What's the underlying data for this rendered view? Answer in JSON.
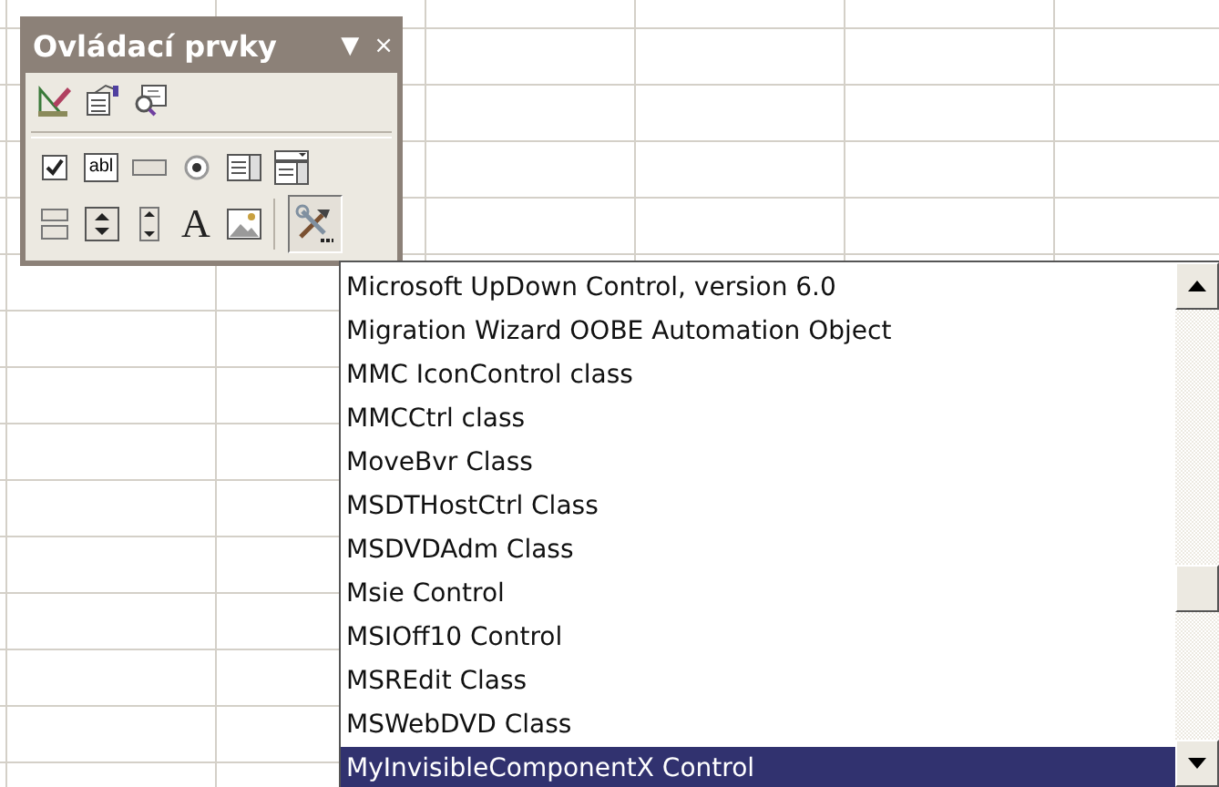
{
  "toolbar": {
    "title": "Ovládací prvky",
    "menu_glyph": "▼",
    "close_glyph": "×",
    "rows": [
      [
        {
          "kind": "design",
          "pressed": false
        },
        {
          "kind": "properties",
          "pressed": false
        },
        {
          "kind": "code",
          "pressed": false
        }
      ],
      [
        {
          "kind": "checkbox",
          "pressed": false
        },
        {
          "kind": "textbox",
          "glyph": "abl",
          "pressed": false
        },
        {
          "kind": "button",
          "pressed": false
        },
        {
          "kind": "option",
          "pressed": false
        },
        {
          "kind": "listbox",
          "pressed": false
        },
        {
          "kind": "combobox",
          "pressed": false
        }
      ],
      [
        {
          "kind": "toggle",
          "pressed": false
        },
        {
          "kind": "spin",
          "pressed": false
        },
        {
          "kind": "scrollbar",
          "pressed": false
        },
        {
          "kind": "label",
          "glyph": "A",
          "pressed": false
        },
        {
          "kind": "image",
          "pressed": false
        },
        {
          "kind": "more",
          "pressed": true
        }
      ]
    ]
  },
  "control_list": {
    "items": [
      {
        "label": "Microsoft UpDown Control, version 6.0",
        "selected": false
      },
      {
        "label": "Migration Wizard OOBE Automation Object",
        "selected": false
      },
      {
        "label": "MMC IconControl class",
        "selected": false
      },
      {
        "label": "MMCCtrl class",
        "selected": false
      },
      {
        "label": "MoveBvr Class",
        "selected": false
      },
      {
        "label": "MSDTHostCtrl Class",
        "selected": false
      },
      {
        "label": "MSDVDAdm Class",
        "selected": false
      },
      {
        "label": "Msie Control",
        "selected": false
      },
      {
        "label": "MSIOff10 Control",
        "selected": false
      },
      {
        "label": "MSREdit Class",
        "selected": false
      },
      {
        "label": "MSWebDVD Class",
        "selected": false
      },
      {
        "label": "MyInvisibleComponentX Control",
        "selected": true
      }
    ]
  }
}
